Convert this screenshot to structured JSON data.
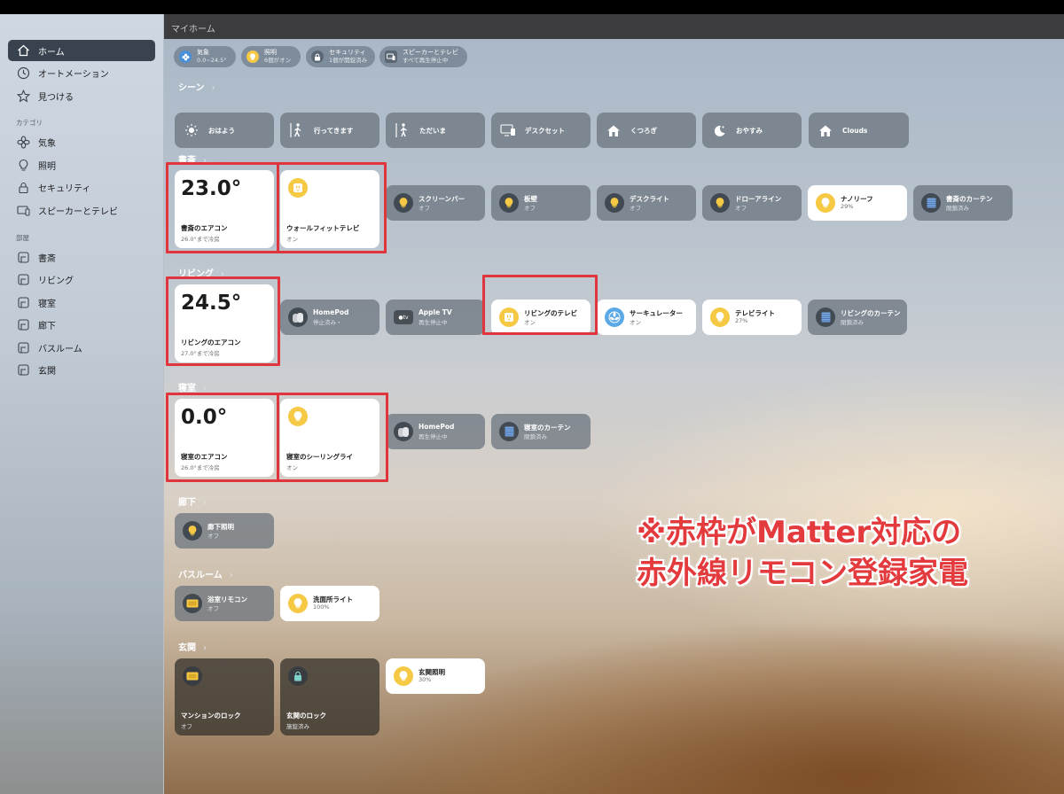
{
  "title": "マイホーム",
  "sidebar": {
    "items": [
      {
        "label": "ホーム",
        "icon": "house-icon"
      },
      {
        "label": "オートメーション",
        "icon": "clock-icon"
      },
      {
        "label": "見つける",
        "icon": "star-icon"
      }
    ],
    "category_header": "カテゴリ",
    "categories": [
      {
        "label": "気象",
        "icon": "fan-icon"
      },
      {
        "label": "照明",
        "icon": "lightbulb-icon"
      },
      {
        "label": "セキュリティ",
        "icon": "lock-icon"
      },
      {
        "label": "スピーカーとテレビ",
        "icon": "tv-icon"
      }
    ],
    "rooms_header": "部屋",
    "rooms": [
      "書斎",
      "リビング",
      "寝室",
      "廊下",
      "バスルーム",
      "玄関"
    ]
  },
  "summary": [
    {
      "title": "気象",
      "sub": "0.0~24.5°",
      "color": "#4a90d9"
    },
    {
      "title": "照明",
      "sub": "6個がオン",
      "color": "#f6c945"
    },
    {
      "title": "セキュリティ",
      "sub": "1個が開錠済み",
      "color": "#5b6775"
    },
    {
      "title": "スピーカーとテレビ",
      "sub": "すべて再生停止中",
      "color": "#5b6775"
    }
  ],
  "scenes_label": "シーン",
  "scenes": [
    "おはよう",
    "行ってきます",
    "ただいま",
    "デスクセット",
    "くつろぎ",
    "おやすみ",
    "Clouds"
  ],
  "rooms": {
    "study": {
      "label": "書斎",
      "ac": {
        "temp": "23.0°",
        "name": "書斎のエアコン",
        "status": "26.0°まで冷房"
      },
      "tv": {
        "name": "ウォールフィットテレビ",
        "status": "オン"
      },
      "tiles": [
        {
          "name": "スクリーンバー",
          "status": "オフ"
        },
        {
          "name": "板壁",
          "status": "オフ"
        },
        {
          "name": "デスクライト",
          "status": "オフ"
        },
        {
          "name": "ドローアライン",
          "status": "オフ"
        },
        {
          "name": "ナノリーフ",
          "status": "29%"
        },
        {
          "name": "書斎のカーテン",
          "status": "閉鎖済み"
        }
      ]
    },
    "living": {
      "label": "リビング",
      "ac": {
        "temp": "24.5°",
        "name": "リビングのエアコン",
        "status": "27.0°まで冷房"
      },
      "tiles": [
        {
          "name": "HomePod",
          "status": "停止済み・"
        },
        {
          "name": "Apple TV",
          "status": "再生停止中"
        },
        {
          "name": "リビングのテレビ",
          "status": "オン"
        },
        {
          "name": "サーキュレーター",
          "status": "オン"
        },
        {
          "name": "テレビライト",
          "status": "27%"
        },
        {
          "name": "リビングのカーテン",
          "status": "閉鎖済み"
        }
      ]
    },
    "bedroom": {
      "label": "寝室",
      "ac": {
        "temp": "0.0°",
        "name": "寝室のエアコン",
        "status": "26.0°まで冷房"
      },
      "light": {
        "name": "寝室のシーリングライ",
        "status": "オン"
      },
      "tiles": [
        {
          "name": "HomePod",
          "status": "再生停止中"
        },
        {
          "name": "寝室のカーテン",
          "status": "閉鎖済み"
        }
      ]
    },
    "hallway": {
      "label": "廊下",
      "tiles": [
        {
          "name": "廊下照明",
          "status": "オフ"
        }
      ]
    },
    "bathroom": {
      "label": "バスルーム",
      "tiles": [
        {
          "name": "浴室リモコン",
          "status": "オフ"
        },
        {
          "name": "洗面所ライト",
          "status": "100%"
        }
      ]
    },
    "entrance": {
      "label": "玄関",
      "big_tiles": [
        {
          "name": "マンションのロック",
          "status": "オフ"
        },
        {
          "name": "玄関のロック",
          "status": "施錠済み"
        }
      ],
      "tiles": [
        {
          "name": "玄関照明",
          "status": "30%"
        }
      ]
    }
  },
  "annotation": {
    "line1": "※赤枠がMatter対応の",
    "line2": "赤外線リモコン登録家電",
    "color": "#e33a3d"
  }
}
